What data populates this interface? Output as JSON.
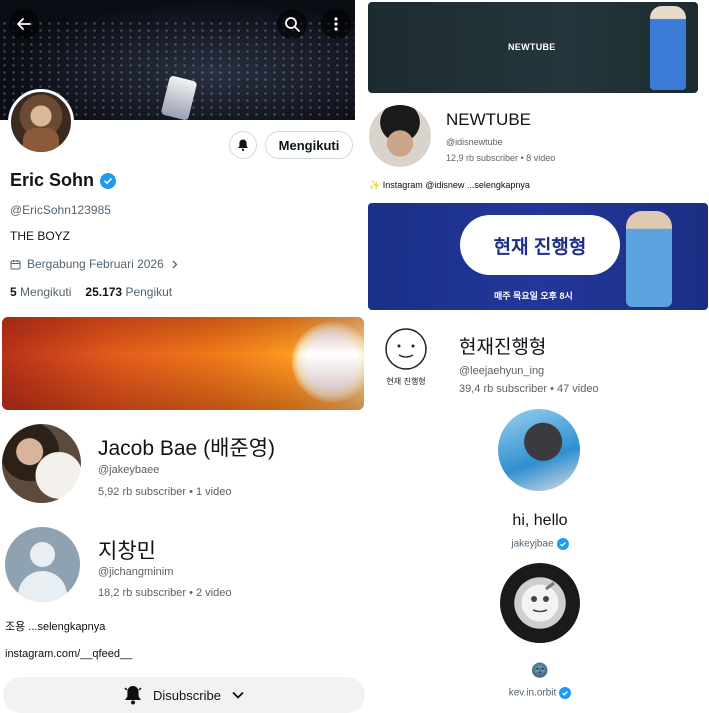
{
  "profile": {
    "name": "Eric Sohn",
    "handle": "@EricSohn123985",
    "bio": "THE BOYZ",
    "joined": "Bergabung Februari 2026",
    "following_count": "5",
    "following_label": "Mengikuti",
    "followers_count": "25.173",
    "followers_label": "Pengikut",
    "follow_button": "Mengikuti"
  },
  "channels_left": [
    {
      "name": "Jacob Bae (배준영)",
      "handle": "@jakeybaee",
      "stats": "5,92 rb subscriber • 1 video"
    },
    {
      "name": "지창민",
      "handle": "@jichangminim",
      "stats": "18,2 rb subscriber • 2 video",
      "desc": "조용 ...selengkapnya",
      "link": "instagram.com/__qfeed__"
    }
  ],
  "unsubscribe_label": "Disubscribe",
  "channels_right": [
    {
      "banner_text": "NEWTUBE",
      "name": "NEWTUBE",
      "handle": "@idisnewtube",
      "stats": "12,9 rb subscriber • 8 video",
      "desc": "✨ Instagram @idisnew ...selengkapnya"
    },
    {
      "banner_title": "현재 진행형",
      "banner_sub": "매주 목요일 오후 8시",
      "name": "현재진행형",
      "handle": "@leejaehyun_ing",
      "stats": "39,4 rb subscriber • 47 video",
      "logo_text": "현재 진행형"
    }
  ],
  "accounts_right": [
    {
      "display_name": "hi, hello",
      "handle": "jakeyjbae"
    },
    {
      "display_name": "🌚",
      "handle": "kev.in.orbit"
    }
  ],
  "colors": {
    "verified": "#1d9bf0",
    "blue_banner": "#23379a"
  }
}
